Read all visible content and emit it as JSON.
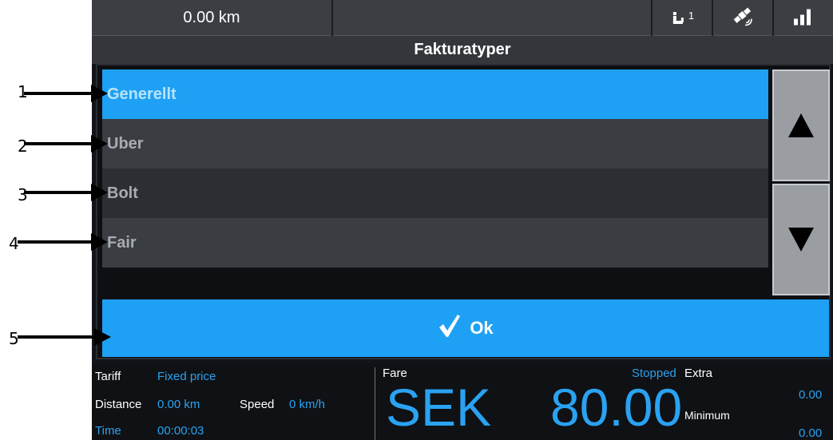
{
  "status_bar": {
    "distance": "0.00 km",
    "passenger_count": "1",
    "icons": [
      "passenger-seat-icon",
      "satellite-gps-icon",
      "signal-strength-icon"
    ]
  },
  "dialog": {
    "title": "Fakturatyper",
    "items": [
      {
        "label": "Generellt",
        "selected": true
      },
      {
        "label": "Uber",
        "selected": false
      },
      {
        "label": "Bolt",
        "selected": false
      },
      {
        "label": "Fair",
        "selected": false
      }
    ],
    "scroll_up_icon": "triangle-up-icon",
    "scroll_down_icon": "triangle-down-icon",
    "ok_label": "Ok",
    "ok_icon": "checkmark-icon"
  },
  "meter": {
    "tariff_label": "Tariff",
    "tariff_value": "Fixed price",
    "distance_label": "Distance",
    "distance_value": "0.00 km",
    "speed_label": "Speed",
    "speed_value": "0 km/h",
    "time_label": "Time",
    "time_value": "00:00:03",
    "fare_label": "Fare",
    "status": "Stopped",
    "extra_label": "Extra",
    "extra_value": "0.00",
    "currency": "SEK",
    "fare_amount": "80.00",
    "minimum_label": "Minimum",
    "minimum_value": "0.00"
  },
  "annotations": [
    "1",
    "2",
    "3",
    "4",
    "5"
  ],
  "colors": {
    "accent": "#1ea0f5",
    "background": "#111418",
    "list_row_a": "#3a3d42",
    "list_row_b": "#2b2e32",
    "scroll_button": "#9a9ea3"
  }
}
